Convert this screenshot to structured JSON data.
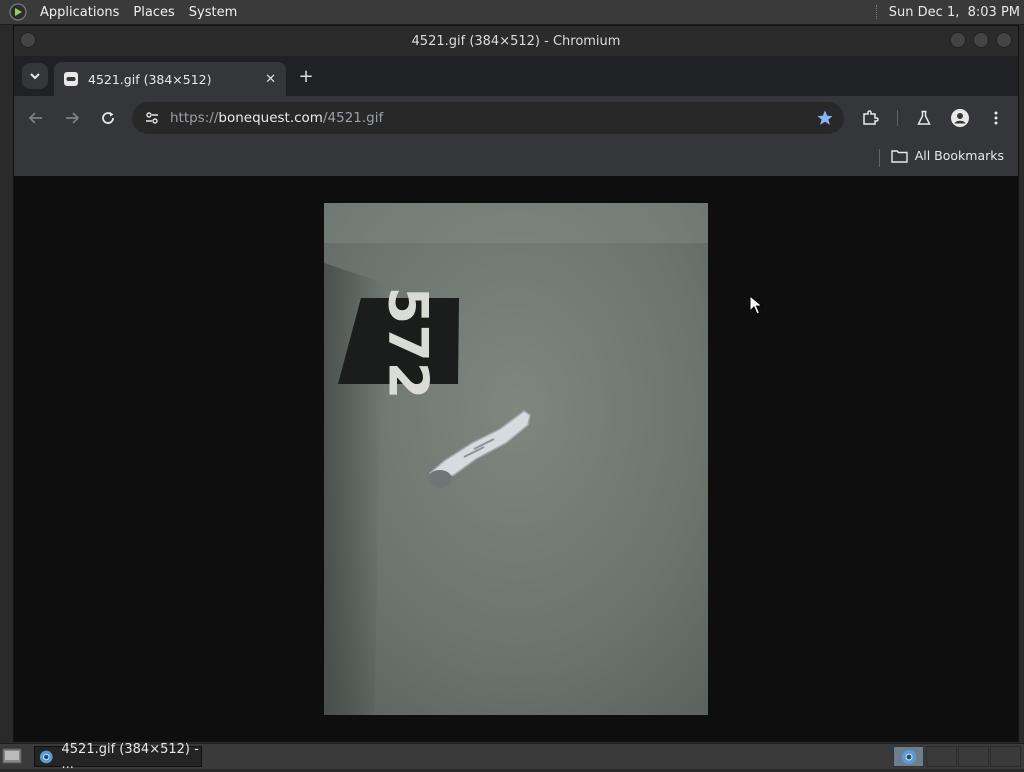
{
  "panel": {
    "menus": [
      "Applications",
      "Places",
      "System"
    ],
    "clock": "Sun Dec 1,  8:03 PM"
  },
  "window": {
    "title": "4521.gif (384×512) - Chromium"
  },
  "tabs": [
    {
      "title": "4521.gif (384×512)",
      "active": true
    }
  ],
  "toolbar": {
    "url_scheme": "https://",
    "url_host": "bonequest.com",
    "url_path": "/4521.gif",
    "bookmarked": true
  },
  "bookmarks_bar": {
    "all_bookmarks_label": "All Bookmarks"
  },
  "content": {
    "image_text": "572"
  },
  "taskbar": {
    "tasks": [
      {
        "label": "4521.gif (384×512) - ..."
      }
    ]
  },
  "colors": {
    "page_background": "#0e0e0e",
    "star_accent": "#8ab4f8",
    "toolbar": "#35363a"
  }
}
